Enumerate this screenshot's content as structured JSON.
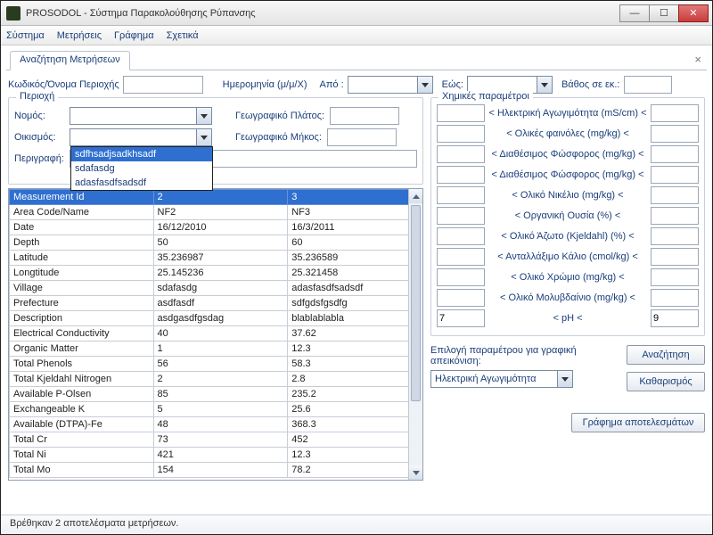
{
  "window": {
    "title": "PROSODOL - Σύστημα Παρακολούθησης Ρύπανσης"
  },
  "menu": {
    "system": "Σύστημα",
    "measurements": "Μετρήσεις",
    "chart": "Γράφημα",
    "about": "Σχετικά"
  },
  "tab": {
    "label": "Αναζήτηση Μετρήσεων"
  },
  "filters": {
    "code_label": "Κωδικός/Όνομα Περιοχής",
    "date_label": "Ημερομηνία (μ/μ/Χ)",
    "from_label": "Από :",
    "to_label": "Εώς:",
    "depth_label": "Βάθος σε εκ.:"
  },
  "region": {
    "legend": "Περιοχή",
    "nomos_label": "Νομός:",
    "oikismos_label": "Οικισμός:",
    "description_label": "Περιγραφή:",
    "lat_label": "Γεωγραφικό Πλάτος:",
    "lon_label": "Γεωγραφικό Μήκος:",
    "dropdown_items": [
      "sdfhsadjsadkhsadf",
      "sdafasdg",
      "adasfasdfsadsdf"
    ]
  },
  "chem": {
    "legend": "Χημικές παραμέτροι",
    "rows": [
      "< Ηλεκτρική Αγωγιμότητα (mS/cm) <",
      "< Ολικές φαινόλες (mg/kg) <",
      "< Διαθέσιμος Φώσφορος (mg/kg) <",
      "< Διαθέσιμος Φώσφορος (mg/kg) <",
      "< Ολικό Νικέλιο (mg/kg) <",
      "< Οργανική Ουσία (%) <",
      "< Ολικό Άζωτο (Kjeldahl) (%) <",
      "< Ανταλλάξιμο Κάλιο (cmol/kg) <",
      "< Ολικό Χρώμιο (mg/kg) <",
      "< Ολικό Μολυβδαίνιο (mg/kg) <",
      "< pH <"
    ],
    "ph_low": "7",
    "ph_high": "9"
  },
  "grid": {
    "headers": [
      "Measurement Id",
      "2",
      "3"
    ],
    "rows": [
      [
        "Area Code/Name",
        "NF2",
        "NF3"
      ],
      [
        "Date",
        "16/12/2010",
        "16/3/2011"
      ],
      [
        "Depth",
        "50",
        "60"
      ],
      [
        "Latitude",
        "35.236987",
        "35.236589"
      ],
      [
        "Longtitude",
        "25.145236",
        "25.321458"
      ],
      [
        "Village",
        "sdafasdg",
        "adasfasdfsadsdf"
      ],
      [
        "Prefecture",
        "asdfasdf",
        "sdfgdsfgsdfg"
      ],
      [
        "Description",
        "asdgasdfgsdag",
        "blablablabla"
      ],
      [
        "Electrical Conductivity",
        "40",
        "37.62"
      ],
      [
        "Organic Matter",
        "1",
        "12.3"
      ],
      [
        "Total Phenols",
        "56",
        "58.3"
      ],
      [
        "Total Kjeldahl Nitrogen",
        "2",
        "2.8"
      ],
      [
        "Available P-Olsen",
        "85",
        "235.2"
      ],
      [
        "Exchangeable K",
        "5",
        "25.6"
      ],
      [
        "Available (DTPA)-Fe",
        "48",
        "368.3"
      ],
      [
        "Total Cr",
        "73",
        "452"
      ],
      [
        "Total Ni",
        "421",
        "12.3"
      ],
      [
        "Total Mo",
        "154",
        "78.2"
      ]
    ]
  },
  "select_param": {
    "label": "Επιλογή παραμέτρου για γραφική απεικόνιση:",
    "value": "Ηλεκτρική Αγωγιμότητα"
  },
  "buttons": {
    "search": "Αναζήτηση",
    "clear": "Καθαρισμός",
    "chart": "Γράφημα αποτελεσμάτων"
  },
  "status": "Βρέθηκαν 2 αποτελέσματα μετρήσεων."
}
